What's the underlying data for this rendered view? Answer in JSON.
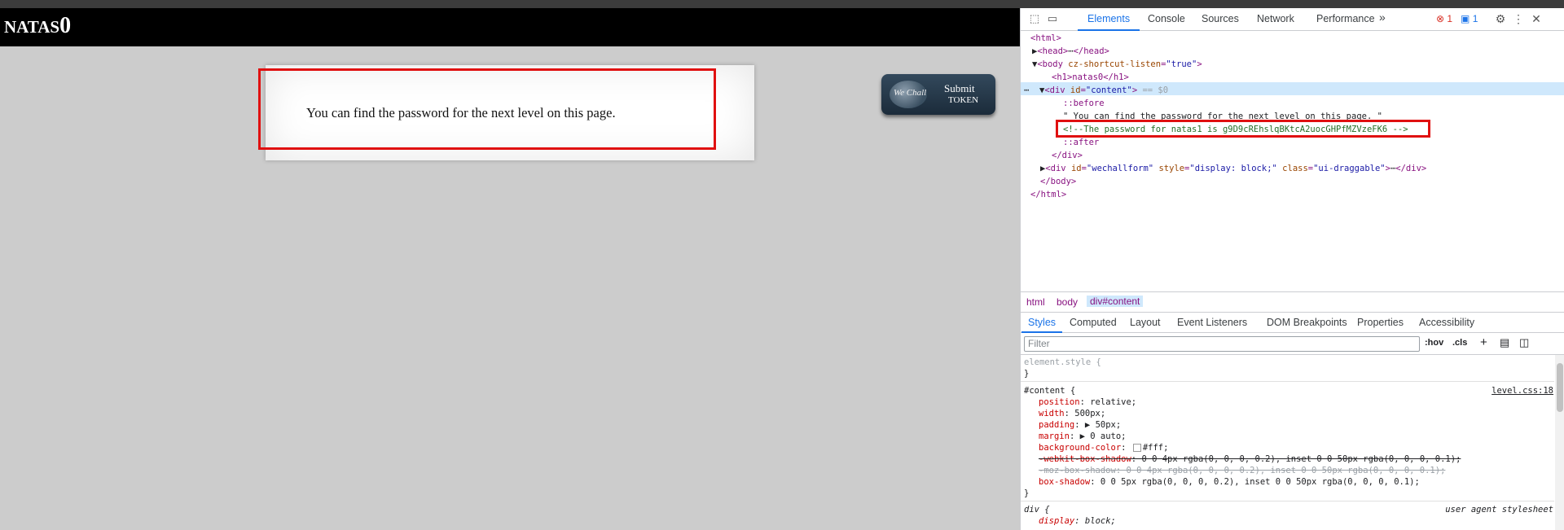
{
  "page": {
    "heading_prefix": "NATAS",
    "heading_num": "0",
    "content_text": "You can find the password for the next level on this page.",
    "wechall": {
      "logo_text": "We Chall",
      "submit1": "Submit",
      "submit2": "TOKEN"
    }
  },
  "devtools": {
    "tabs": [
      "Elements",
      "Console",
      "Sources",
      "Network",
      "Performance"
    ],
    "more": "»",
    "error_count": "1",
    "message_count": "1",
    "dom": {
      "l1": "<html>",
      "l2_open": "<head>",
      "l2_close": "</head>",
      "l3_tag": "<body ",
      "l3_attr": "cz-shortcut-listen",
      "l3_val": "\"true\"",
      "l4": "<h1>natas0</h1>",
      "l5_tag": "<div ",
      "l5_attr": "id",
      "l5_val": "\"content\"",
      "l5_suffix": " == $0",
      "l6": "::before",
      "l7": "\" You can find the password for the next level on this page. \"",
      "l8": "<!--The password for natas1 is g9D9cREhslqBKtcA2uocGHPfMZVzeFK6 -->",
      "l9": "::after",
      "l10": "</div>",
      "l11_tag": "<div ",
      "l11_attr1": "id",
      "l11_val1": "\"wechallform\"",
      "l11_attr2": "style",
      "l11_val2": "\"display: block;\"",
      "l11_attr3": "class",
      "l11_val3": "\"ui-draggable\"",
      "l11_close": "</div>",
      "l12": "</body>",
      "l13": "</html>"
    },
    "breadcrumbs": [
      "html",
      "body",
      "div#content"
    ],
    "subtabs": [
      "Styles",
      "Computed",
      "Layout",
      "Event Listeners",
      "DOM Breakpoints",
      "Properties",
      "Accessibility"
    ],
    "filter_placeholder": "Filter",
    "hov": ":hov",
    "cls": ".cls",
    "styles": {
      "element_style": "element.style {",
      "close": "}",
      "content_sel": "#content {",
      "content_src": "level.css:18",
      "position_p": "position",
      "position_v": "relative;",
      "width_p": "width",
      "width_v": "500px;",
      "padding_p": "padding",
      "padding_v": "50px;",
      "margin_p": "margin",
      "margin_v": "0 auto;",
      "bg_p": "background-color",
      "bg_v": "#fff;",
      "wk_p": "-webkit-box-shadow",
      "wk_v": "0 0 4px rgba(0, 0, 0, 0.2), inset 0 0 50px rgba(0, 0, 0, 0.1);",
      "moz": "-moz-box-shadow: 0 0 4px rgba(0, 0, 0, 0.2), inset 0 0 50px rgba(0, 0, 0, 0.1);",
      "bs_p": "box-shadow",
      "bs_v": "0 0 5px rgba(0, 0, 0, 0.2), inset 0 0 50px rgba(0, 0, 0, 0.1);",
      "div_sel": "div {",
      "div_src": "user agent stylesheet",
      "display_p": "display",
      "display_v": "block;"
    }
  }
}
